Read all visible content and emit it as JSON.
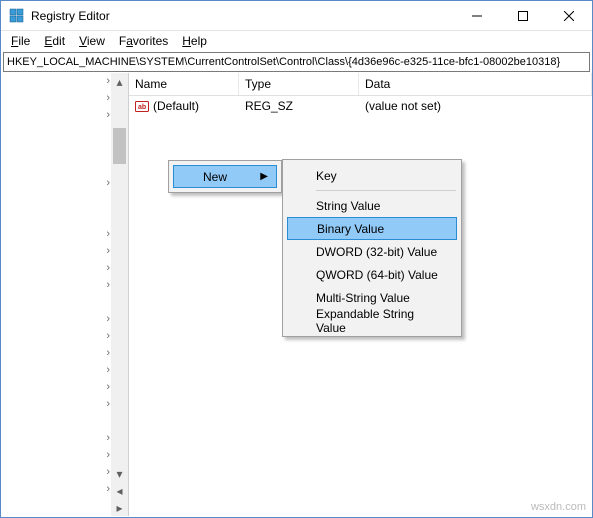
{
  "window": {
    "title": "Registry Editor"
  },
  "menubar": {
    "file": "File",
    "edit": "Edit",
    "view": "View",
    "favorites": "Favorites",
    "help": "Help"
  },
  "address": "HKEY_LOCAL_MACHINE\\SYSTEM\\CurrentControlSet\\Control\\Class\\{4d36e96c-e325-11ce-bfc1-08002be10318}",
  "list": {
    "headers": {
      "name": "Name",
      "type": "Type",
      "data": "Data"
    },
    "rows": [
      {
        "name": "(Default)",
        "type": "REG_SZ",
        "data": "(value not set)"
      }
    ]
  },
  "context": {
    "primary": {
      "new": "New"
    },
    "sub": {
      "key": "Key",
      "string": "String Value",
      "binary": "Binary Value",
      "dword": "DWORD (32-bit) Value",
      "qword": "QWORD (64-bit) Value",
      "multi": "Multi-String Value",
      "expand": "Expandable String Value"
    }
  },
  "watermark": "wsxdn.com"
}
